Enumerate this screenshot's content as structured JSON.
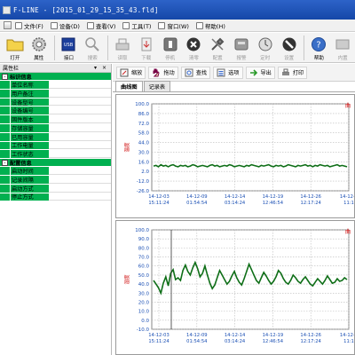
{
  "window": {
    "title": "F-LINE - [2015_01_29_15_35_43.fld]"
  },
  "menu": [
    {
      "label": "文件(F)"
    },
    {
      "label": "设备(D)"
    },
    {
      "label": "查看(V)"
    },
    {
      "label": "工具(T)"
    },
    {
      "label": "窗口(W)"
    },
    {
      "label": "帮助(H)"
    }
  ],
  "toolbar": {
    "open": "打开",
    "properties": "属性",
    "usb": "USB",
    "port": "接口",
    "search": "搜索",
    "download": "读取",
    "upload": "下载",
    "stop": "停机",
    "cancel": "清零",
    "config": "配置",
    "record": "报警",
    "timing": "定时",
    "set": "设置",
    "help": "帮助",
    "exit": "内置"
  },
  "left_panel": {
    "title": "属性栏",
    "controls": "▾ ×",
    "groups": [
      {
        "name": "标识信息",
        "toggle": "-",
        "items": [
          "单位名称",
          "用户备注",
          "设备型号",
          "设备编号",
          "固件版本",
          "存储容量",
          "已用容量",
          "工作电量",
          "工作状态"
        ]
      },
      {
        "name": "配置信息",
        "toggle": "-",
        "items": [
          "启动时间",
          "记录间隔",
          "启动方式",
          "停止方式"
        ]
      }
    ]
  },
  "subtoolbar": {
    "zoom": "缩放",
    "drag": "拖动",
    "find": "查找",
    "options": "选项",
    "export": "导出",
    "print": "打印"
  },
  "tabs": [
    {
      "label": "曲线图",
      "active": true
    },
    {
      "label": "记录表",
      "active": false
    }
  ],
  "colors": {
    "line": "#0e6e17",
    "accent_green": "#00b050",
    "title_blue": "#1a4fb4"
  },
  "chart_data": [
    {
      "type": "line",
      "title": "曲",
      "ylabel": "温度",
      "ylim": [
        -30,
        100
      ],
      "yticks": [
        "100.0",
        "86.0",
        "72.0",
        "58.0",
        "44.0",
        "30.0",
        "16.0",
        "2.0",
        "-12.0",
        "-26.0"
      ],
      "xticks": [
        "14-12-03\n15:11:24",
        "14-12-09\n01:54:54",
        "14-12-14\n03:14:24",
        "14-12-19\n12:46:54",
        "14-12-26\n12:17:24",
        "14-12-3\n11:1"
      ],
      "series": [
        {
          "values": [
            7,
            8,
            6,
            9,
            7,
            8,
            6,
            8,
            9,
            7,
            6,
            8,
            7,
            8,
            6,
            7,
            9,
            8,
            6,
            7,
            8,
            7,
            6,
            8,
            9,
            7,
            8,
            6,
            7,
            8,
            7,
            9,
            8,
            6,
            7,
            8,
            7,
            6,
            8,
            7,
            9,
            8,
            7,
            6,
            8,
            7,
            8,
            9,
            7,
            6,
            8,
            7,
            8,
            6,
            7,
            9,
            8,
            7,
            6,
            8,
            7,
            8,
            9,
            7,
            8,
            6,
            8,
            7,
            9,
            8,
            7,
            8,
            6,
            7,
            8,
            9,
            7,
            8,
            7,
            6
          ]
        }
      ]
    },
    {
      "type": "line",
      "title": "曲",
      "ylabel": "湿度",
      "ylim": [
        -10,
        100
      ],
      "yticks": [
        "100.0",
        "90.0",
        "80.0",
        "70.0",
        "60.0",
        "50.0",
        "40.0",
        "30.0",
        "20.0",
        "10.0",
        "0.0",
        "-10.0"
      ],
      "xticks": [
        "14-12-03\n15:11:24",
        "14-12-09\n01:54:54",
        "14-12-14\n03:14:24",
        "14-12-19\n12:46:54",
        "14-12-26\n12:17:24",
        "14-12-3\n11:1"
      ],
      "series": [
        {
          "values": [
            44,
            40,
            36,
            30,
            41,
            48,
            38,
            52,
            56,
            45,
            47,
            44,
            55,
            61,
            54,
            50,
            58,
            64,
            57,
            48,
            52,
            60,
            50,
            41,
            35,
            39,
            47,
            55,
            50,
            45,
            40,
            43,
            49,
            54,
            47,
            42,
            39,
            46,
            54,
            62,
            56,
            50,
            44,
            41,
            47,
            53,
            49,
            44,
            40,
            43,
            48,
            55,
            52,
            46,
            42,
            40,
            44,
            50,
            47,
            43,
            41,
            45,
            48,
            44,
            40,
            38,
            42,
            46,
            43,
            40,
            44,
            49,
            45,
            41,
            42,
            46,
            43,
            44,
            47,
            45
          ]
        }
      ]
    }
  ]
}
